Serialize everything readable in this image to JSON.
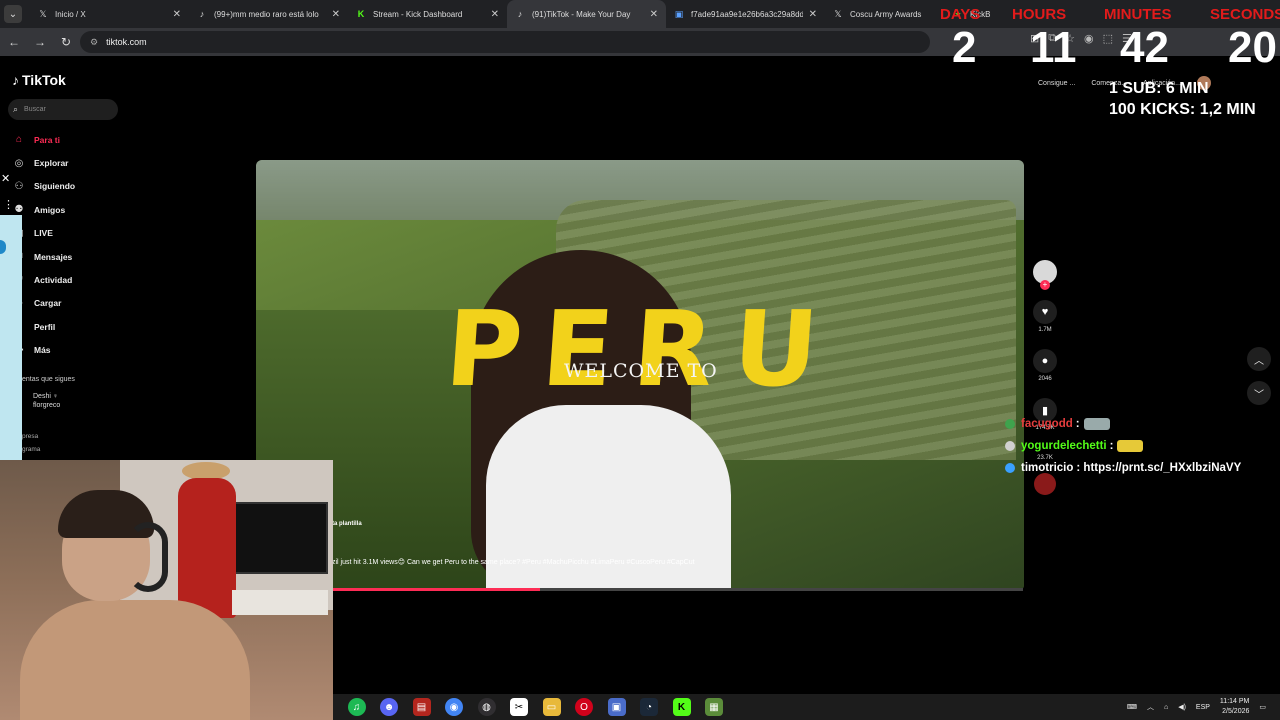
{
  "browser": {
    "tabs": [
      {
        "title": "Inicio / X",
        "icon": "x-logo-icon",
        "active": false
      },
      {
        "title": "(99+)mm medio raro está lolo",
        "icon": "tiktok-icon",
        "active": false
      },
      {
        "title": "Stream - Kick Dashboard",
        "icon": "kick-icon",
        "active": false
      },
      {
        "title": "(91)TikTok - Make Your Day",
        "icon": "tiktok-icon",
        "active": true
      },
      {
        "title": "f7ade91aa9e1e26b6a3c29a8dd",
        "icon": "doc-icon",
        "active": false
      },
      {
        "title": "Coscu Army Awards",
        "icon": "x-logo-icon",
        "active": false
      },
      {
        "title": "KickB",
        "icon": "extension-icon",
        "active": false
      }
    ],
    "url": "tiktok.com",
    "bookmarks": [
      "Consigue ...",
      "Comenza...",
      "Aplicación..."
    ]
  },
  "tiktok": {
    "logo": "TikTok",
    "search_placeholder": "Buscar",
    "nav": [
      {
        "label": "Para ti",
        "icon": "home-icon",
        "active": true
      },
      {
        "label": "Explorar",
        "icon": "compass-icon",
        "active": false
      },
      {
        "label": "Siguiendo",
        "icon": "following-icon",
        "active": false
      },
      {
        "label": "Amigos",
        "icon": "friends-icon",
        "active": false
      },
      {
        "label": "LIVE",
        "icon": "live-icon",
        "active": false
      },
      {
        "label": "Mensajes",
        "icon": "messages-icon",
        "active": false
      },
      {
        "label": "Actividad",
        "icon": "activity-icon",
        "active": false
      },
      {
        "label": "Cargar",
        "icon": "upload-icon",
        "active": false
      },
      {
        "label": "Perfil",
        "icon": "profile-icon",
        "active": false
      },
      {
        "label": "Más",
        "icon": "more-icon",
        "active": false
      }
    ],
    "following_title": "entas que sigues",
    "following_account": {
      "name": "Deshi ♀",
      "handle": "florgreco"
    },
    "footer": [
      "presa",
      "grama"
    ]
  },
  "video": {
    "overlay_big": "PERU",
    "overlay_small": "WELCOME TO",
    "author": "ta plantilla",
    "caption": "zil just hit 3.1M views😊 Can we get Peru to the same place? #Peru #MachuPicchu #LimaPeru #CuscoPeru #CapCut",
    "progress": 0.3,
    "likes": "1.7M",
    "comments": "2046",
    "saves": "174.7K",
    "shares": "23.7K"
  },
  "stream_overlay": {
    "countdown": [
      {
        "label": "DAYS",
        "value": "2"
      },
      {
        "label": "HOURS",
        "value": "11"
      },
      {
        "label": "MINUTES",
        "value": "42"
      },
      {
        "label": "SECONDS",
        "value": "20"
      }
    ],
    "goals": [
      "1 SUB: 6 MIN",
      "100 KICKS: 1,2 MIN"
    ],
    "chat": [
      {
        "user": "facugodd",
        "message": ":",
        "color": "#e63d3d",
        "badge": "#3fa34d"
      },
      {
        "user": "yogurdelechetti",
        "message": ":",
        "color": "#53fc18",
        "badge": "#d0d0d0"
      },
      {
        "user": "timotricio",
        "message": ": https://prnt.sc/_HXxlbziNaVY",
        "color": "#ffffff",
        "badge": "#3aa0ff"
      }
    ]
  },
  "taskbar": {
    "apps": [
      "spotify-icon",
      "discord-icon",
      "voicemeeter-icon",
      "chrome-icon",
      "obs-icon",
      "capcut-icon",
      "folder-icon",
      "opera-icon",
      "app-icon",
      "steam-icon",
      "kick-icon",
      "minecraft-icon"
    ],
    "language": "ESP",
    "time": "11:14 PM",
    "date": "2/5/2026"
  },
  "colors": {
    "tiktok_red": "#fe2c55",
    "countdown_label": "#e21b1b",
    "peru_yellow": "#f2d21b",
    "tab_bar": "#202124",
    "toolbar": "#35363a"
  }
}
